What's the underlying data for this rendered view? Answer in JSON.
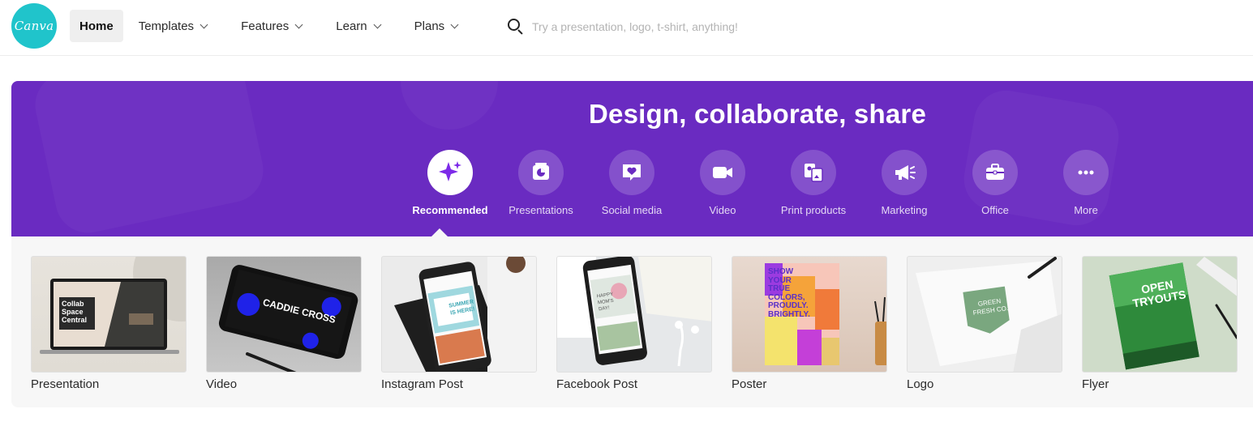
{
  "header": {
    "logo_text": "Canva",
    "nav": [
      {
        "label": "Home",
        "active": true,
        "dropdown": false
      },
      {
        "label": "Templates",
        "dropdown": true
      },
      {
        "label": "Features",
        "dropdown": true
      },
      {
        "label": "Learn",
        "dropdown": true
      },
      {
        "label": "Plans",
        "dropdown": true
      }
    ],
    "search_placeholder": "Try a presentation, logo, t-shirt, anything!"
  },
  "hero": {
    "title": "Design, collaborate, share",
    "background_color": "#6a2bc1",
    "categories": [
      {
        "label": "Recommended",
        "icon": "sparkle-icon",
        "active": true
      },
      {
        "label": "Presentations",
        "icon": "presentation-icon"
      },
      {
        "label": "Social media",
        "icon": "heart-chat-icon"
      },
      {
        "label": "Video",
        "icon": "video-camera-icon"
      },
      {
        "label": "Print products",
        "icon": "print-icon"
      },
      {
        "label": "Marketing",
        "icon": "megaphone-icon"
      },
      {
        "label": "Office",
        "icon": "briefcase-icon"
      },
      {
        "label": "More",
        "icon": "more-dots-icon"
      }
    ]
  },
  "cards": [
    {
      "label": "Presentation",
      "thumb_text": [
        "Collab",
        "Space",
        "Central"
      ]
    },
    {
      "label": "Video",
      "thumb_text": [
        "CADDIE CROSS"
      ]
    },
    {
      "label": "Instagram Post",
      "thumb_text": [
        "SUMMER",
        "IS HERE!"
      ]
    },
    {
      "label": "Facebook Post",
      "thumb_text": [
        "HAPPY",
        "MOM'S",
        "DAY!"
      ]
    },
    {
      "label": "Poster",
      "thumb_text": [
        "SHOW",
        "YOUR",
        "TRUE",
        "COLORS,",
        "PROUDLY.",
        "BRIGHTLY."
      ]
    },
    {
      "label": "Logo",
      "thumb_text": [
        "GREEN",
        "FRESH CO."
      ]
    },
    {
      "label": "Flyer",
      "thumb_text": [
        "OPEN",
        "TRYOUTS"
      ]
    }
  ],
  "colors": {
    "brand_teal": "#20c4cb",
    "hero_purple": "#6a2bc1",
    "accent_purple": "#7d2ae8"
  }
}
